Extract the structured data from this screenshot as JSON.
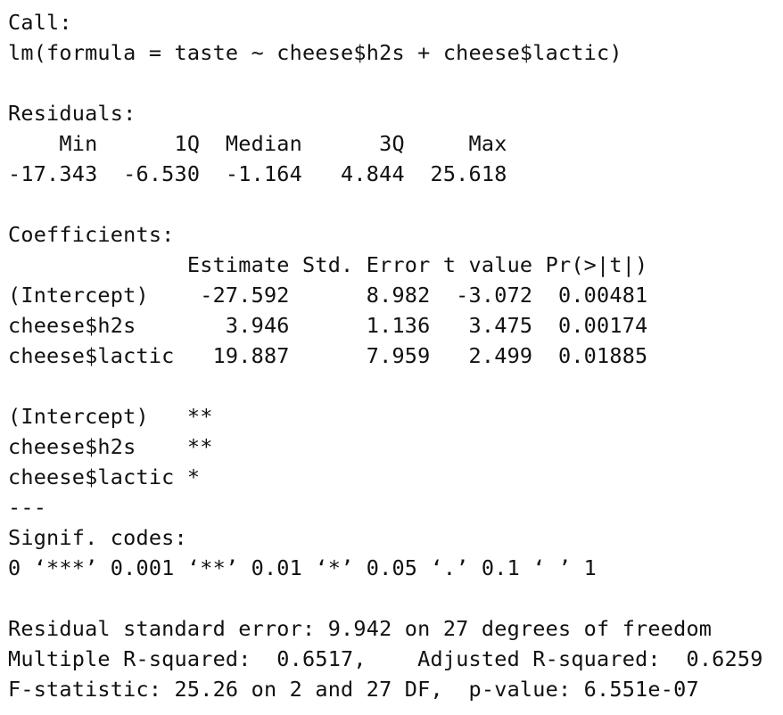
{
  "lines": [
    "Call:",
    "lm(formula = taste ~ cheese$h2s + cheese$lactic)",
    "",
    "Residuals:",
    "    Min      1Q  Median      3Q     Max ",
    "-17.343  -6.530  -1.164   4.844  25.618 ",
    "",
    "Coefficients:",
    "              Estimate Std. Error t value Pr(>|t|)",
    "(Intercept)    -27.592      8.982  -3.072  0.00481",
    "cheese$h2s       3.946      1.136   3.475  0.00174",
    "cheese$lactic   19.887      7.959   2.499  0.01885",
    "",
    "(Intercept)   **",
    "cheese$h2s    **",
    "cheese$lactic *",
    "---",
    "Signif. codes:",
    "0 ‘***’ 0.001 ‘**’ 0.01 ‘*’ 0.05 ‘.’ 0.1 ‘ ’ 1",
    "",
    "Residual standard error: 9.942 on 27 degrees of freedom",
    "Multiple R-squared:  0.6517,\tAdjusted R-squared:  0.6259 ",
    "F-statistic: 25.26 on 2 and 27 DF,  p-value: 6.551e-07"
  ]
}
